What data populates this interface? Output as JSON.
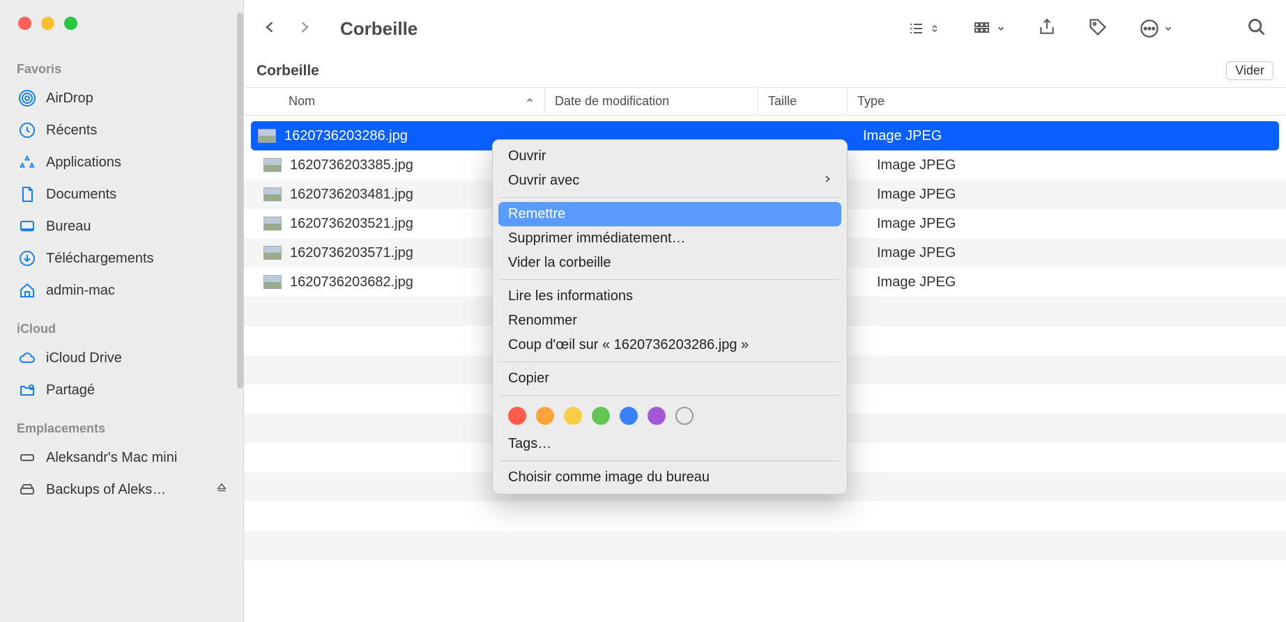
{
  "window": {
    "title": "Corbeille",
    "subheader_title": "Corbeille",
    "empty_button": "Vider"
  },
  "sidebar": {
    "sections": {
      "favorites": {
        "title": "Favoris"
      },
      "icloud": {
        "title": "iCloud"
      },
      "locations": {
        "title": "Emplacements"
      }
    },
    "favorites": [
      {
        "label": "AirDrop"
      },
      {
        "label": "Récents"
      },
      {
        "label": "Applications"
      },
      {
        "label": "Documents"
      },
      {
        "label": "Bureau"
      },
      {
        "label": "Téléchargements"
      },
      {
        "label": "admin-mac"
      }
    ],
    "icloud": [
      {
        "label": "iCloud Drive"
      },
      {
        "label": "Partagé"
      }
    ],
    "locations": [
      {
        "label": "Aleksandr's Mac mini"
      },
      {
        "label": "Backups of Aleks…",
        "eject": true
      }
    ]
  },
  "columns": {
    "name": "Nom",
    "date": "Date de modification",
    "size": "Taille",
    "type": "Type"
  },
  "files": [
    {
      "name": "1620736203286.jpg",
      "date": "",
      "size": "",
      "type": "Image JPEG",
      "selected": true
    },
    {
      "name": "1620736203385.jpg",
      "date": "",
      "size": "",
      "type": "Image JPEG"
    },
    {
      "name": "1620736203481.jpg",
      "date": "",
      "size": "",
      "type": "Image JPEG"
    },
    {
      "name": "1620736203521.jpg",
      "date": "",
      "size": "",
      "type": "Image JPEG"
    },
    {
      "name": "1620736203571.jpg",
      "date": "",
      "size": "",
      "type": "Image JPEG"
    },
    {
      "name": "1620736203682.jpg",
      "date": "",
      "size": "",
      "type": "Image JPEG"
    }
  ],
  "context_menu": {
    "items": [
      {
        "label": "Ouvrir"
      },
      {
        "label": "Ouvrir avec",
        "submenu": true
      }
    ],
    "items2": [
      {
        "label": "Remettre",
        "highlight": true
      },
      {
        "label": "Supprimer immédiatement…"
      },
      {
        "label": "Vider la corbeille"
      }
    ],
    "items3": [
      {
        "label": "Lire les informations"
      },
      {
        "label": "Renommer"
      },
      {
        "label": "Coup d'œil sur « 1620736203286.jpg »"
      }
    ],
    "items4": [
      {
        "label": "Copier"
      }
    ],
    "tags_label": "Tags…",
    "tag_colors": [
      "#ff5c49",
      "#f9a33b",
      "#f7ce45",
      "#63c558",
      "#3a82f7",
      "#a357d7"
    ],
    "items5": [
      {
        "label": "Choisir comme image du bureau"
      }
    ]
  }
}
